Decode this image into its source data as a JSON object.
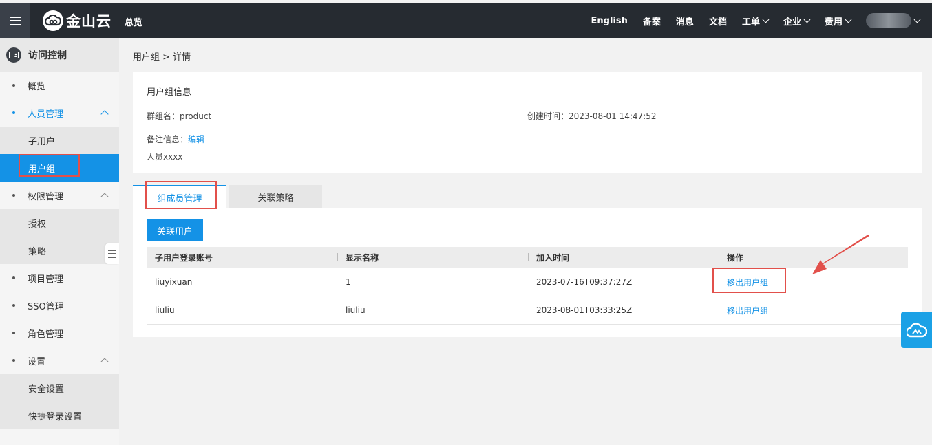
{
  "topbar": {
    "logo_text": "金山云",
    "overview": "总览",
    "nav": [
      {
        "label": "English",
        "dropdown": false
      },
      {
        "label": "备案",
        "dropdown": false
      },
      {
        "label": "消息",
        "dropdown": false
      },
      {
        "label": "文档",
        "dropdown": false
      },
      {
        "label": "工单",
        "dropdown": true
      },
      {
        "label": "企业",
        "dropdown": true
      },
      {
        "label": "费用",
        "dropdown": true
      }
    ]
  },
  "sidebar": {
    "title": "访问控制",
    "items": [
      {
        "label": "概览"
      },
      {
        "label": "人员管理"
      },
      {
        "label": "子用户"
      },
      {
        "label": "用户组"
      },
      {
        "label": "权限管理"
      },
      {
        "label": "授权"
      },
      {
        "label": "策略"
      },
      {
        "label": "项目管理"
      },
      {
        "label": "SSO管理"
      },
      {
        "label": "角色管理"
      },
      {
        "label": "设置"
      },
      {
        "label": "安全设置"
      },
      {
        "label": "快捷登录设置"
      }
    ]
  },
  "breadcrumb": "用户组 > 详情",
  "group_info": {
    "title": "用户组信息",
    "name_label": "群组名：",
    "name_value": "product",
    "created_label": "创建时间：",
    "created_value": "2023-08-01 14:47:52",
    "remark_label": "备注信息：",
    "edit_link": "编辑",
    "remark_value": "人员xxxx"
  },
  "tabs": [
    {
      "label": "组成员管理",
      "active": true
    },
    {
      "label": "关联策略",
      "active": false
    }
  ],
  "members": {
    "link_user_button": "关联用户",
    "columns": [
      "子用户登录账号",
      "显示名称",
      "加入时间",
      "操作"
    ],
    "rows": [
      {
        "account": "liuyixuan",
        "display_name": "1",
        "joined": "2023-07-16T09:37:27Z",
        "action": "移出用户组"
      },
      {
        "account": "liuliu",
        "display_name": "liuliu",
        "joined": "2023-08-01T03:33:25Z",
        "action": "移出用户组"
      }
    ]
  },
  "colors": {
    "accent": "#1492e6",
    "topbar": "#262b31",
    "annotation": "#e2504b"
  }
}
